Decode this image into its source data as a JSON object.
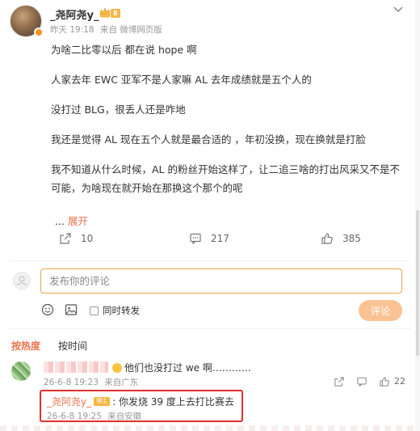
{
  "post": {
    "username": "_尧阿尧y_",
    "level_badge": "8",
    "time": "昨天 19:18",
    "source": "来自 微博网页版",
    "paragraphs": [
      "为啥二比零以后  都在说 hope 啊",
      "人家去年 EWC 亚军不是人家嘛  AL 去年成绩就是五个人的",
      "没打过 BLG，很丢人还是咋地",
      "我还是觉得 AL 现在五个人就是最合适的 ，年初没换，现在换就是打脸",
      "我不知道从什么时候，AL 的粉丝开始这样了，让二追三啥的打出风采又不是不可能，为啥现在就开始在那换这个那个的呢"
    ],
    "ellipsis": "...",
    "expand_label": "展开",
    "forward_count": "10",
    "comment_count": "217",
    "like_count": "385"
  },
  "composer": {
    "placeholder": "发布你的评论",
    "forward_label": "同时转发",
    "submit_label": "评论"
  },
  "tabs": {
    "hot": "按热度",
    "time": "按时间"
  },
  "comment": {
    "text": "他们也没打过 we 啊…………",
    "meta_time": "26-6-8 19:23",
    "meta_source": "来自广东",
    "like_count": "22"
  },
  "reply": {
    "username": "_尧阿尧y_",
    "badge": "博主",
    "text": ": 你发烧 39 度上去打比赛去",
    "time": "26-6-8 19:25",
    "source": "来自安徽"
  },
  "colors": {
    "accent": "#eb7350",
    "highlight_border": "#e0302d",
    "submit_bg": "#fbc394",
    "input_border": "#f0a24a"
  }
}
